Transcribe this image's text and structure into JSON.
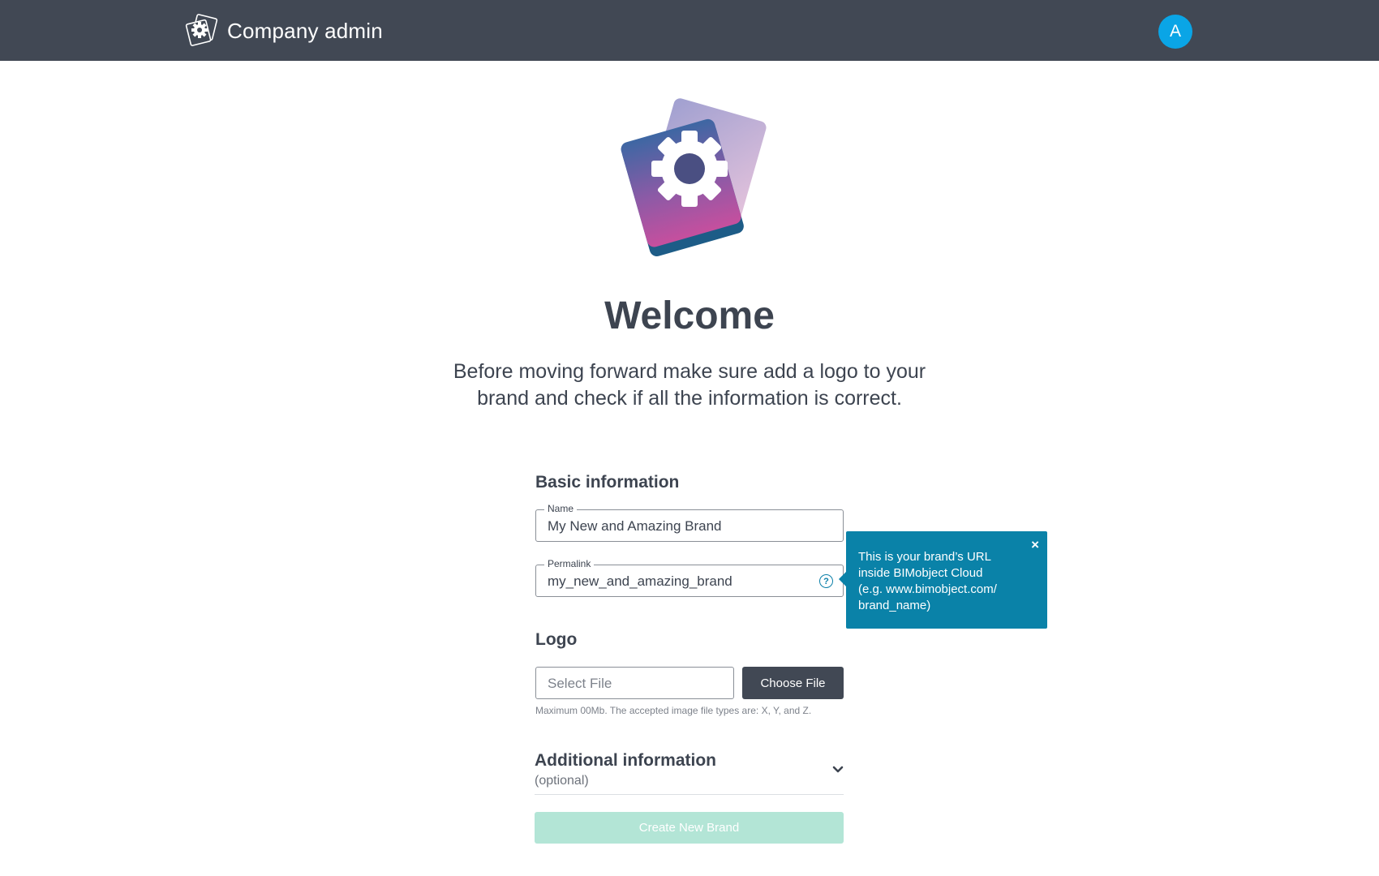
{
  "header": {
    "title": "Company admin",
    "avatar_initial": "A"
  },
  "hero": {
    "heading": "Welcome",
    "intro_line1": "Before moving forward make sure add a logo to your",
    "intro_line2": "brand and check if all the information is correct."
  },
  "basic_info": {
    "title": "Basic information",
    "name_label": "Name",
    "name_value": "My New and Amazing Brand",
    "permalink_label": "Permalink",
    "permalink_value": "my_new_and_amazing_brand"
  },
  "tooltip": {
    "close": "×",
    "line1": "This is your brand’s URL",
    "line2": "inside BIMobject Cloud",
    "line3": "(e.g. www.bimobject.com/",
    "line4": "brand_name)"
  },
  "logo": {
    "title": "Logo",
    "file_placeholder": "Select File",
    "choose_button": "Choose File",
    "hint": "Maximum 00Mb. The accepted image file types are: X, Y, and Z."
  },
  "additional": {
    "title": "Additional information",
    "subtitle": "(optional)"
  },
  "actions": {
    "create_button": "Create New Brand"
  },
  "colors": {
    "header_bg": "#414854",
    "avatar": "#0aa5e6",
    "tooltip_bg": "#0a82a8",
    "create_button_disabled": "#b3e5d6"
  },
  "icons": {
    "brand": "company-admin-gear-icon",
    "help": "question-circle-icon",
    "close": "close-icon",
    "expand": "chevron-down-icon"
  }
}
